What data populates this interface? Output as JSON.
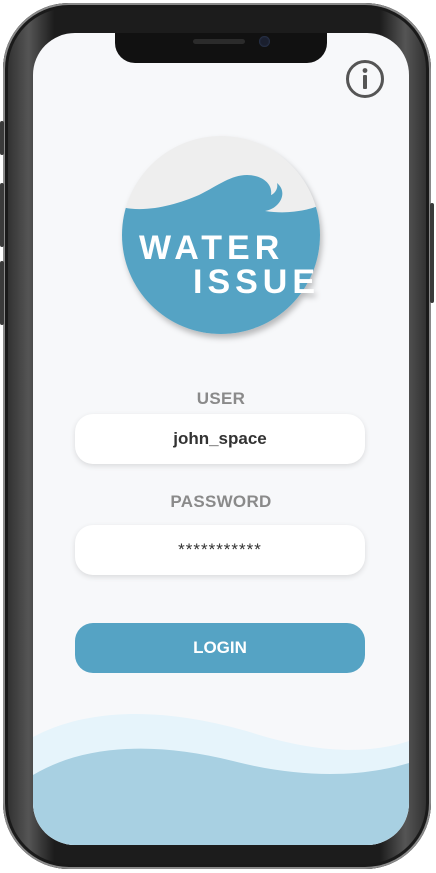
{
  "logo": {
    "line1": "WATER",
    "line2": "ISSUE"
  },
  "form": {
    "user_label": "USER",
    "user_value": "john_space",
    "password_label": "PASSWORD",
    "password_value": "***********",
    "login_label": "LOGIN"
  },
  "icons": {
    "info": "info-icon"
  },
  "colors": {
    "accent": "#55a3c4",
    "logo_light": "#eeeeee",
    "background": "#f7f8fa",
    "label": "#8a8a8a",
    "wave_light": "#e6f4fb",
    "wave_dark": "#a8d0e2"
  }
}
